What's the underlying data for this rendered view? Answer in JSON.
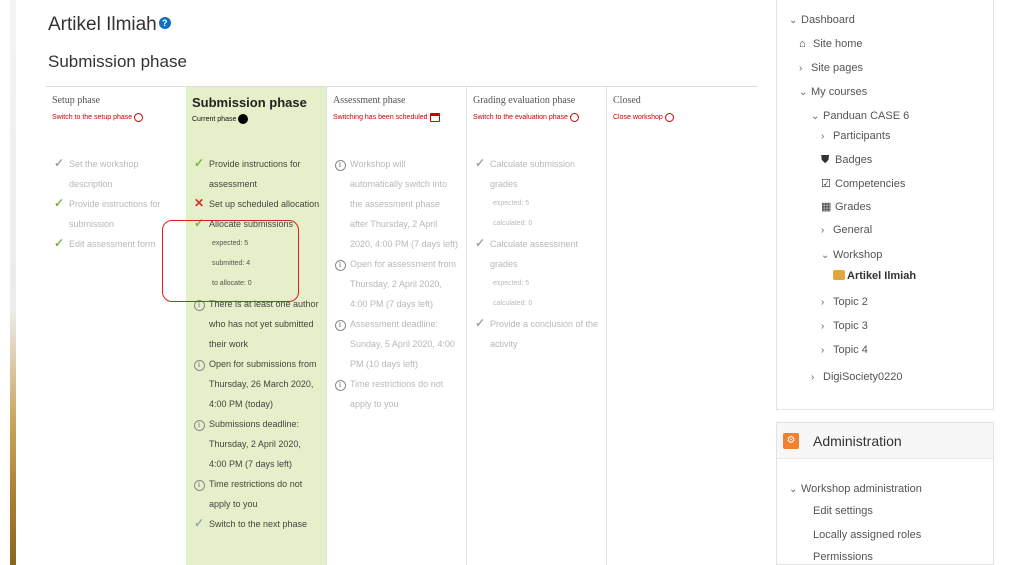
{
  "header": {
    "title": "Artikel Ilmiah",
    "help_icon": "?",
    "phase_heading": "Submission phase"
  },
  "phases": [
    {
      "name": "Setup phase",
      "action": "Switch to the setup phase",
      "tasks": [
        {
          "status": "done",
          "text": "Set the workshop description"
        },
        {
          "status": "done",
          "text": "Provide instructions for submission"
        },
        {
          "status": "done",
          "text": "Edit assessment form"
        }
      ]
    },
    {
      "name": "Submission phase",
      "action": "Current phase",
      "tasks": [
        {
          "status": "done",
          "text": "Provide instructions for assessment"
        },
        {
          "status": "fail",
          "text": "Set up scheduled allocation"
        },
        {
          "status": "done",
          "text": "Allocate submissions",
          "details": [
            "expected: 5",
            "submitted: 4",
            "to allocate: 0"
          ]
        },
        {
          "status": "info",
          "text": "There is at least one author who has not yet submitted their work"
        },
        {
          "status": "info",
          "text": "Open for submissions from Thursday, 26 March 2020, 4:00 PM (today)"
        },
        {
          "status": "info",
          "text": "Submissions deadline: Thursday, 2 April 2020, 4:00 PM (7 days left)"
        },
        {
          "status": "info",
          "text": "Time restrictions do not apply to you"
        },
        {
          "status": "todo",
          "text": "Switch to the next phase"
        }
      ]
    },
    {
      "name": "Assessment phase",
      "action": "Switching has been scheduled",
      "tasks": [
        {
          "status": "info",
          "text": "Workshop will automatically switch into the assessment phase after Thursday, 2 April 2020, 4:00 PM (7 days left)"
        },
        {
          "status": "info",
          "text": "Open for assessment from Thursday, 2 April 2020, 4:00 PM (7 days left)"
        },
        {
          "status": "info",
          "text": "Assessment deadline: Sunday, 5 April 2020, 4:00 PM (10 days left)"
        },
        {
          "status": "info",
          "text": "Time restrictions do not apply to you"
        }
      ]
    },
    {
      "name": "Grading evaluation phase",
      "action": "Switch to the evaluation phase",
      "tasks": [
        {
          "status": "todo",
          "text": "Calculate submission grades",
          "details": [
            "expected: 5",
            "calculated: 0"
          ]
        },
        {
          "status": "todo",
          "text": "Calculate assessment grades",
          "details": [
            "expected: 5",
            "calculated: 0"
          ]
        },
        {
          "status": "todo",
          "text": "Provide a conclusion of the activity"
        }
      ]
    },
    {
      "name": "Closed",
      "action": "Close workshop",
      "tasks": []
    }
  ],
  "navigation": {
    "dashboard": "Dashboard",
    "site_home": "Site home",
    "site_pages": "Site pages",
    "my_courses": "My courses",
    "course": "Panduan CASE 6",
    "participants": "Participants",
    "badges": "Badges",
    "competencies": "Competencies",
    "grades": "Grades",
    "general": "General",
    "workshop": "Workshop",
    "current_activity": "Artikel Ilmiah",
    "topic2": "Topic 2",
    "topic3": "Topic 3",
    "topic4": "Topic 4",
    "other_course": "DigiSociety0220"
  },
  "administration": {
    "title": "Administration",
    "workshop_admin": "Workshop administration",
    "items": [
      "Edit settings",
      "Locally assigned roles",
      "Permissions"
    ]
  },
  "colors": {
    "active_phase_bg": "#e5efc9",
    "check": "#7bb637",
    "fail": "#d03030",
    "link_red": "#cc0000",
    "admin_badge": "#f0822d"
  }
}
